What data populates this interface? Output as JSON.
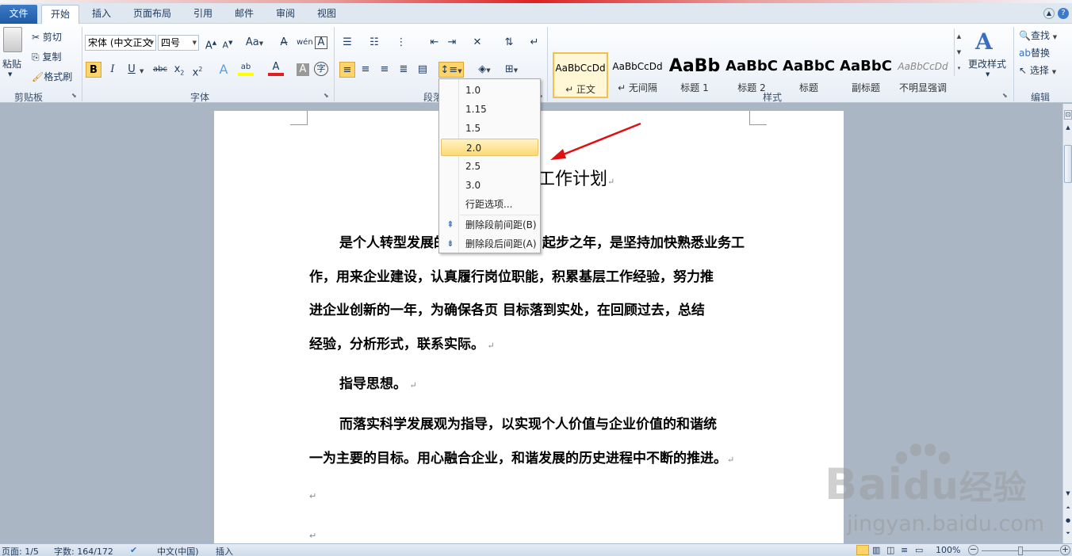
{
  "tabs": [
    "文件",
    "开始",
    "插入",
    "页面布局",
    "引用",
    "邮件",
    "审阅",
    "视图"
  ],
  "clipboard": {
    "paste": "粘贴",
    "cut": "剪切",
    "copy": "复制",
    "format_painter": "格式刷",
    "group": "剪贴板"
  },
  "font": {
    "name": "宋体 (中文正文",
    "size": "四号",
    "group": "字体",
    "aa": "Aa"
  },
  "paragraph": {
    "group": "段落"
  },
  "styles": {
    "group": "样式",
    "items": [
      {
        "sample": "AaBbCcDd",
        "name": "↵ 正文"
      },
      {
        "sample": "AaBbCcDd",
        "name": "↵ 无间隔"
      },
      {
        "sample": "AaBb",
        "name": "标题 1"
      },
      {
        "sample": "AaBbC",
        "name": "标题 2"
      },
      {
        "sample": "AaBbC",
        "name": "标题"
      },
      {
        "sample": "AaBbC",
        "name": "副标题"
      },
      {
        "sample": "AaBbCcDd",
        "name": "不明显强调"
      }
    ],
    "change": "更改样式"
  },
  "editing": {
    "group": "编辑",
    "find": "查找",
    "replace": "替换",
    "select": "选择"
  },
  "line_spacing_menu": {
    "items": [
      "1.0",
      "1.15",
      "1.5",
      "2.0",
      "2.5",
      "3.0"
    ],
    "selected": "2.0",
    "options": "行距选项...",
    "remove_before": "删除段前间距(B)",
    "remove_after": "删除段后间距(A)"
  },
  "document": {
    "title": "工作计划",
    "p1": [
      "是个人转型发展的",
      "起步之年，是坚持加快熟悉业务工",
      "作，用来企业建设，认真履行岗位职能，积累基层工作经验，努力推",
      "进企业创新的一年，为确保各页 目标落到实处，在回顾过去，总结",
      "经验，分析形式，联系实际。"
    ],
    "p2": "指导思想。",
    "p3": [
      "而落实科学发展观为指导，以实现个人价值与企业价值的和谐统",
      "一为主要的目标。用心融合企业，和谐发展的历史进程中不断的推进。"
    ]
  },
  "status": {
    "page": "页面: 1/5",
    "words": "字数: 164/172",
    "lang": "中文(中国)",
    "mode": "插入",
    "zoom": "100%"
  },
  "watermark": {
    "brand": "Bai",
    "brand2": "经验",
    "url": "jingyan.baidu.com"
  }
}
